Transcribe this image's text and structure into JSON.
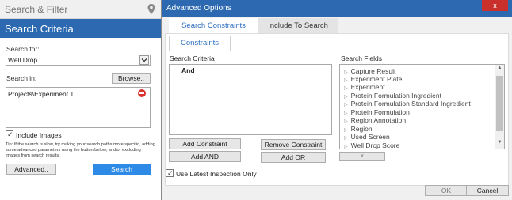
{
  "left_panel": {
    "header_title": "Search & Filter",
    "section_title": "Search Criteria",
    "search_for_label": "Search for:",
    "search_for_value": "Well Drop",
    "search_in_label": "Search in:",
    "browse_label": "Browse..",
    "path_value": "Projects\\Experiment 1",
    "include_images_label": "Include Images",
    "include_images_checked": true,
    "tip_text": "Tip: If the search is slow, try making your search paths more specific, adding some advanced parameters using the button below, and/or excluding images from search results.",
    "advanced_label": "Advanced..",
    "search_label": "Search"
  },
  "dialog": {
    "title": "Advanced Options",
    "close_label": "x",
    "tabs": [
      {
        "label": "Search Constraints",
        "active": true
      },
      {
        "label": "Include To Search",
        "active": false
      }
    ],
    "subtab_label": "Constraints",
    "criteria_label": "Search Criteria",
    "criteria_root": "And",
    "fields_label": "Search Fields",
    "fields": [
      "Capture Result",
      "Experiment Plate",
      "Experiment",
      "Protein Formulation Ingredient",
      "Protein Formulation Standard Ingredient",
      "Protein Formulation",
      "Region Annotation",
      "Region",
      "Used Screen",
      "Well Drop Score"
    ],
    "buttons": {
      "add_constraint": "Add Constraint",
      "remove_constraint": "Remove Constraint",
      "add_and": "Add AND",
      "add_or": "Add OR"
    },
    "use_latest_label": "Use Latest Inspection Only",
    "use_latest_checked": true,
    "ok_label": "OK",
    "cancel_label": "Cancel"
  },
  "colors": {
    "accent": "#2d69b1",
    "search_button": "#2d8ae6",
    "close_button": "#c9302c"
  }
}
